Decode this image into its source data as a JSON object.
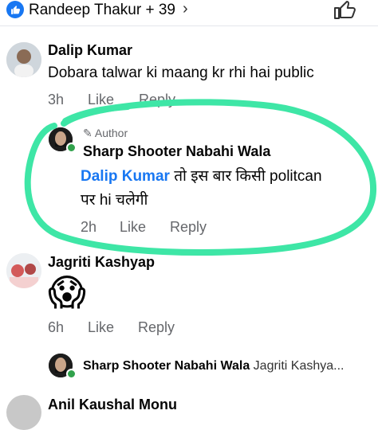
{
  "reactions": {
    "summary": "Randeep Thakur + 39",
    "chevron": "›",
    "like_icon": "like-badge-icon",
    "accent": "#1877f2"
  },
  "comment1": {
    "name": "Dalip Kumar",
    "text": "Dobara talwar ki maang kr rhi hai public",
    "time": "3h",
    "like": "Like",
    "reply": "Reply"
  },
  "reply1": {
    "author_label": "Author",
    "name": "Sharp Shooter Nabahi Wala",
    "mention": "Dalip Kumar",
    "text_line1": " तो इस बार किसी politcan",
    "text_line2": "पर hi चलेगी",
    "time": "2h",
    "like": "Like",
    "reply": "Reply"
  },
  "comment2": {
    "name": "Jagriti Kashyap",
    "emoji": "😱",
    "time": "6h",
    "like": "Like",
    "reply": "Reply"
  },
  "reply2_preview": {
    "name": "Sharp Shooter Nabahi Wala",
    "snippet": "Jagriti Kashya..."
  },
  "comment3": {
    "name": "Anil Kaushal Monu"
  },
  "colors": {
    "highlight": "#3ee6a6",
    "online": "#31a24c",
    "meta": "#65676b"
  }
}
